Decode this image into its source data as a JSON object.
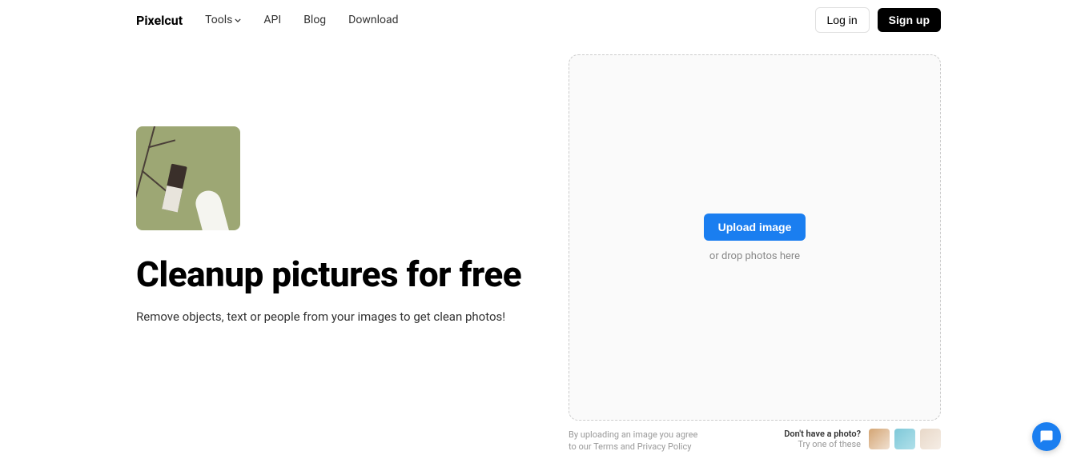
{
  "header": {
    "logo": "Pixelcut",
    "nav": {
      "tools": "Tools",
      "api": "API",
      "blog": "Blog",
      "download": "Download"
    },
    "login": "Log in",
    "signup": "Sign up"
  },
  "hero": {
    "headline": "Cleanup pictures for free",
    "subheadline": "Remove objects, text or people from your images to get clean photos!"
  },
  "dropzone": {
    "upload_button": "Upload image",
    "drop_text": "or drop photos here"
  },
  "terms": {
    "line1": "By uploading an image you agree",
    "line2_prefix": "to our ",
    "terms_link": "Terms",
    "and": " and ",
    "privacy_link": "Privacy Policy"
  },
  "samples": {
    "title": "Don't have a photo?",
    "subtitle": "Try one of these"
  }
}
